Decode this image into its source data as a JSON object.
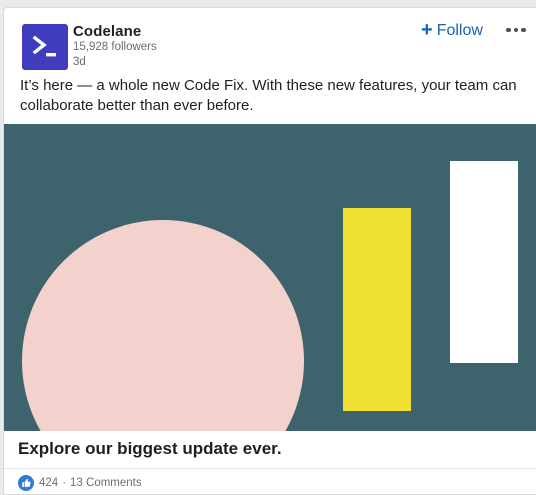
{
  "post": {
    "company": {
      "name": "Codelane",
      "followers": "15,928 followers",
      "time": "3d",
      "logo": {
        "icon": "terminal-prompt-icon",
        "background": "#3f3dbd",
        "foreground": "#ffffff"
      }
    },
    "actions": {
      "follow_plus": "+",
      "follow_label": "Follow",
      "more_icon": "ellipsis-icon"
    },
    "text": "It’s here — a whole new Code Fix. With these new features, your team can collaborate better than ever before.",
    "image": {
      "background": "#3d636c",
      "shapes": [
        {
          "kind": "circle",
          "color": "#f3d1cc"
        },
        {
          "kind": "rectangle",
          "color": "#f0e032"
        },
        {
          "kind": "rectangle",
          "color": "#ffffff"
        }
      ]
    },
    "headline": "Explore our biggest update ever.",
    "social": {
      "reaction_icon": "thumbs-up-icon",
      "reactions": "424",
      "separator": "·",
      "comments": "13 Comments"
    }
  },
  "colors": {
    "accent": "#1a61b8",
    "text_primary": "#1f1f1f",
    "text_secondary": "#6b6d70"
  }
}
